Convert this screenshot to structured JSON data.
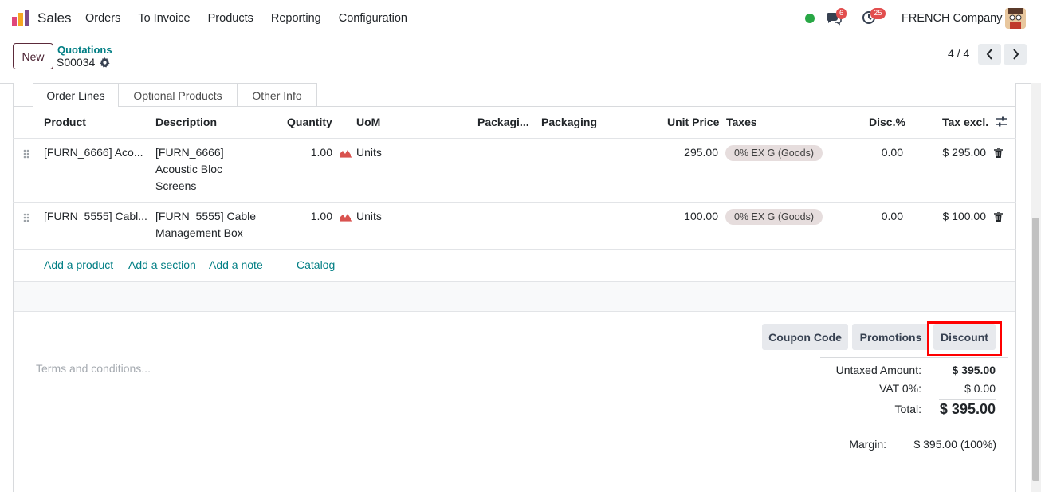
{
  "nav": {
    "app_name": "Sales",
    "menu": [
      "Orders",
      "To Invoice",
      "Products",
      "Reporting",
      "Configuration"
    ],
    "messages_count": "6",
    "activities_count": "25",
    "company": "FRENCH Company"
  },
  "control_panel": {
    "new_label": "New",
    "breadcrumb_parent": "Quotations",
    "breadcrumb_current": "S00034",
    "pager": "4 / 4"
  },
  "tabs": [
    "Order Lines",
    "Optional Products",
    "Other Info"
  ],
  "table": {
    "headers": {
      "product": "Product",
      "description": "Description",
      "quantity": "Quantity",
      "uom": "UoM",
      "packaging_qty": "Packagi...",
      "packaging": "Packaging",
      "unit_price": "Unit Price",
      "taxes": "Taxes",
      "discount": "Disc.%",
      "subtotal": "Tax excl."
    },
    "rows": [
      {
        "product": "[FURN_6666] Aco...",
        "description_lines": [
          "[FURN_6666]",
          "Acoustic Bloc",
          "Screens"
        ],
        "quantity": "1.00",
        "uom": "Units",
        "unit_price": "295.00",
        "tax": "0% EX G (Goods)",
        "discount": "0.00",
        "subtotal": "$ 295.00"
      },
      {
        "product": "[FURN_5555] Cabl...",
        "description_lines": [
          "[FURN_5555] Cable",
          "Management Box"
        ],
        "quantity": "1.00",
        "uom": "Units",
        "unit_price": "100.00",
        "tax": "0% EX G (Goods)",
        "discount": "0.00",
        "subtotal": "$ 100.00"
      }
    ],
    "add_links": [
      "Add a product",
      "Add a section",
      "Add a note",
      "Catalog"
    ]
  },
  "actions": {
    "coupon": "Coupon Code",
    "promotions": "Promotions",
    "discount": "Discount"
  },
  "terms_placeholder": "Terms and conditions...",
  "totals": {
    "untaxed_label": "Untaxed Amount:",
    "untaxed_value": "$ 395.00",
    "vat_label": "VAT 0%:",
    "vat_value": "$ 0.00",
    "total_label": "Total:",
    "total_value": "$ 395.00",
    "margin_label": "Margin:",
    "margin_value": "$ 395.00 (100%)"
  },
  "colors": {
    "link": "#017e84",
    "primary": "#714b67",
    "highlight": "#ff0000"
  }
}
